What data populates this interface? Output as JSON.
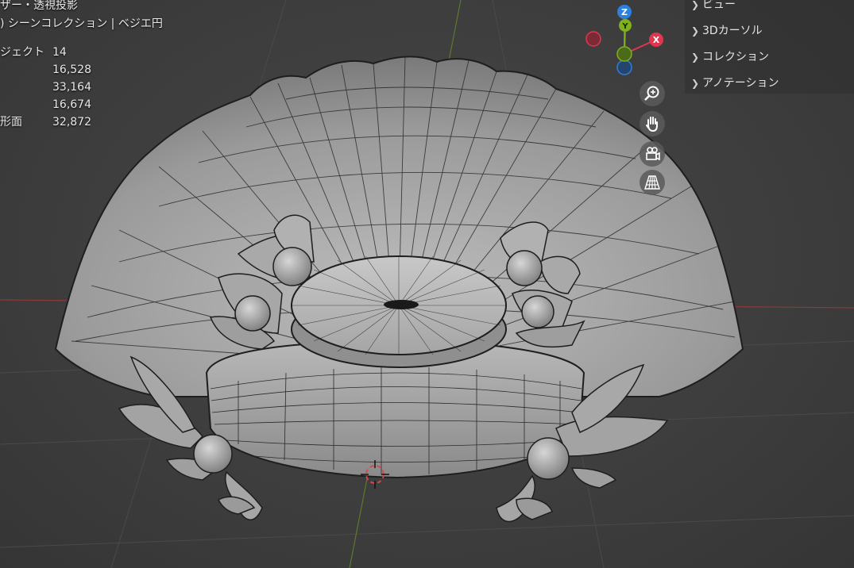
{
  "overlay": {
    "header_line1": "ザー・透視投影",
    "header_line2": ") シーンコレクション | ベジエ円",
    "stats": [
      {
        "label": "ジェクト",
        "value": "14"
      },
      {
        "label": "",
        "value": "16,528"
      },
      {
        "label": "",
        "value": "33,164"
      },
      {
        "label": "",
        "value": "16,674"
      },
      {
        "label": "形面",
        "value": "32,872"
      }
    ]
  },
  "sidebar": {
    "items": [
      {
        "label": "ビュー"
      },
      {
        "label": "3Dカーソル"
      },
      {
        "label": "コレクション"
      },
      {
        "label": "アノテーション"
      }
    ]
  },
  "gizmo": {
    "z_label": "Z",
    "y_label": "Y",
    "x_label": "X",
    "colors": {
      "x": "#e0364f",
      "y": "#7fb01d",
      "z": "#2c80e0"
    }
  },
  "nav_buttons": [
    "zoom-icon",
    "hand-pan-icon",
    "camera-icon",
    "grid-perspective-icon"
  ]
}
